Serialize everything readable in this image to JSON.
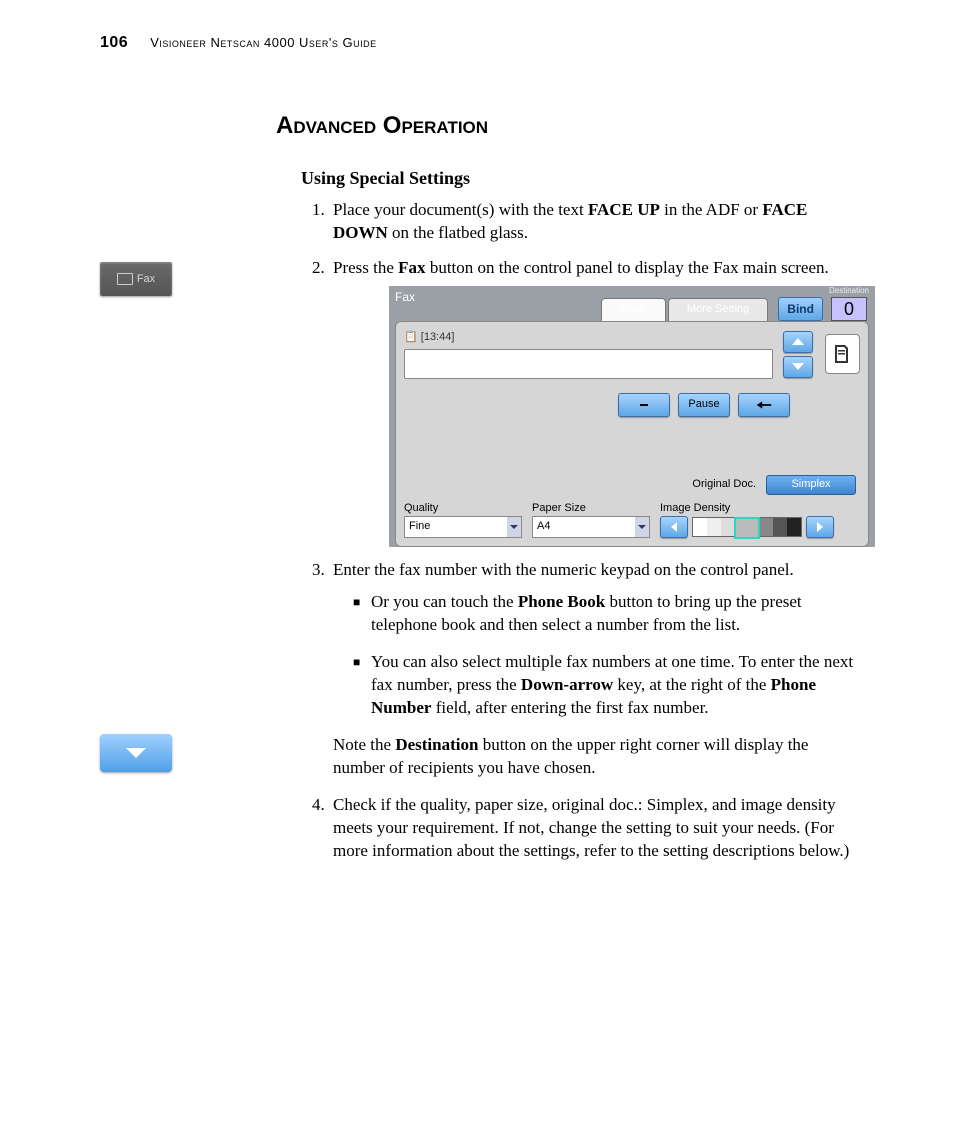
{
  "page_number": "106",
  "header_text": "Visioneer Netscan 4000 User's Guide",
  "section_title": "Advanced Operation",
  "subsection_title": "Using Special Settings",
  "margin_fax_label": "Fax",
  "steps": {
    "s1_a": "Place your document(s) with the text ",
    "s1_b": "FACE UP",
    "s1_c": " in the ADF or ",
    "s1_d": "FACE DOWN",
    "s1_e": " on the flatbed glass.",
    "s2_a": "Press the ",
    "s2_b": "Fax",
    "s2_c": " button on the control panel to display the Fax main screen.",
    "s3": "Enter the fax number with the numeric keypad on the control panel.",
    "s3_bullet1_a": "Or you can touch the ",
    "s3_bullet1_b": "Phone Book",
    "s3_bullet1_c": " button to bring up the preset telephone book and then select a number from the list.",
    "s3_bullet2_a": "You can also select multiple fax numbers at one time. To enter the next fax number, press the ",
    "s3_bullet2_b": "Down-arrow",
    "s3_bullet2_c": " key, at the right of the ",
    "s3_bullet2_d": "Phone Number",
    "s3_bullet2_e": " field, after entering the first fax number.",
    "s3_note_a": "Note the ",
    "s3_note_b": "Destination",
    "s3_note_c": " button on the upper right corner will display the number of recipients you have chosen.",
    "s4": "Check if the quality, paper size, original doc.: Simplex, and image density meets your requirement. If not, change the setting to suit your needs. (For more information about the settings, refer to the setting descriptions below.)"
  },
  "fax_screen": {
    "title": "Fax",
    "tab_basic": "Basic",
    "tab_more": "More Setting",
    "bind": "Bind",
    "destination_label": "Destination",
    "destination_value": "0",
    "time": "[13:44]",
    "pause": "Pause",
    "original_doc": "Original Doc.",
    "simplex": "Simplex",
    "quality_label": "Quality",
    "quality_value": "Fine",
    "paper_label": "Paper Size",
    "paper_value": "A4",
    "density_label": "Image Density"
  }
}
